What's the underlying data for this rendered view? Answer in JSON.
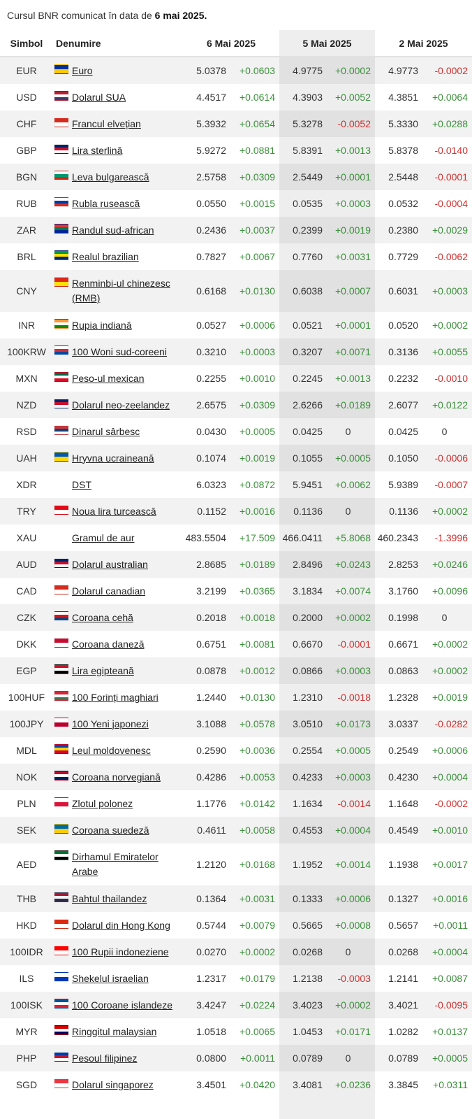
{
  "caption": {
    "prefix": "Cursul BNR comunicat în data de",
    "date": "6 mai 2025."
  },
  "headers": {
    "symbol": "Simbol",
    "name": "Denumire",
    "d1": "6 Mai 2025",
    "d2": "5 Mai 2025",
    "d3": "2 Mai 2025"
  },
  "rows": [
    {
      "sym": "EUR",
      "name": "Euro",
      "flag": [
        "#003399",
        "#ffcc00"
      ],
      "v1": "5.0378",
      "c1": "+0.0603",
      "v2": "4.9775",
      "c2": "+0.0002",
      "v3": "4.9773",
      "c3": "-0.0002"
    },
    {
      "sym": "USD",
      "name": "Dolarul SUA",
      "flag": [
        "#b22234",
        "#ffffff",
        "#3c3b6e"
      ],
      "v1": "4.4517",
      "c1": "+0.0614",
      "v2": "4.3903",
      "c2": "+0.0052",
      "v3": "4.3851",
      "c3": "+0.0064"
    },
    {
      "sym": "CHF",
      "name": "Francul elvețian",
      "flag": [
        "#d52b1e",
        "#ffffff"
      ],
      "v1": "5.3932",
      "c1": "+0.0654",
      "v2": "5.3278",
      "c2": "-0.0052",
      "v3": "5.3330",
      "c3": "+0.0288"
    },
    {
      "sym": "GBP",
      "name": "Lira sterlină",
      "flag": [
        "#012169",
        "#c8102e",
        "#ffffff"
      ],
      "v1": "5.9272",
      "c1": "+0.0881",
      "v2": "5.8391",
      "c2": "+0.0013",
      "v3": "5.8378",
      "c3": "-0.0140"
    },
    {
      "sym": "BGN",
      "name": "Leva bulgarească",
      "flag": [
        "#ffffff",
        "#00966e",
        "#d62612"
      ],
      "v1": "2.5758",
      "c1": "+0.0309",
      "v2": "2.5449",
      "c2": "+0.0001",
      "v3": "2.5448",
      "c3": "-0.0001"
    },
    {
      "sym": "RUB",
      "name": "Rubla rusească",
      "flag": [
        "#ffffff",
        "#0039a6",
        "#d52b1e"
      ],
      "v1": "0.0550",
      "c1": "+0.0015",
      "v2": "0.0535",
      "c2": "+0.0003",
      "v3": "0.0532",
      "c3": "-0.0004"
    },
    {
      "sym": "ZAR",
      "name": "Randul sud-african",
      "flag": [
        "#de3831",
        "#007a4d",
        "#002395"
      ],
      "v1": "0.2436",
      "c1": "+0.0037",
      "v2": "0.2399",
      "c2": "+0.0019",
      "v3": "0.2380",
      "c3": "+0.0029"
    },
    {
      "sym": "BRL",
      "name": "Realul brazilian",
      "flag": [
        "#009c3b",
        "#ffdf00",
        "#002776"
      ],
      "v1": "0.7827",
      "c1": "+0.0067",
      "v2": "0.7760",
      "c2": "+0.0031",
      "v3": "0.7729",
      "c3": "-0.0062"
    },
    {
      "sym": "CNY",
      "name": "Renminbi-ul chinezesc (RMB)",
      "tall": true,
      "flag": [
        "#de2910",
        "#ffde00"
      ],
      "v1": "0.6168",
      "c1": "+0.0130",
      "v2": "0.6038",
      "c2": "+0.0007",
      "v3": "0.6031",
      "c3": "+0.0003"
    },
    {
      "sym": "INR",
      "name": "Rupia indiană",
      "flag": [
        "#ff9933",
        "#ffffff",
        "#138808"
      ],
      "v1": "0.0527",
      "c1": "+0.0006",
      "v2": "0.0521",
      "c2": "+0.0001",
      "v3": "0.0520",
      "c3": "+0.0002"
    },
    {
      "sym": "100KRW",
      "name": "100 Woni sud-coreeni",
      "flag": [
        "#ffffff",
        "#cd2e3a",
        "#0047a0"
      ],
      "v1": "0.3210",
      "c1": "+0.0003",
      "v2": "0.3207",
      "c2": "+0.0071",
      "v3": "0.3136",
      "c3": "+0.0055"
    },
    {
      "sym": "MXN",
      "name": "Peso-ul mexican",
      "flag": [
        "#006847",
        "#ffffff",
        "#ce1126"
      ],
      "v1": "0.2255",
      "c1": "+0.0010",
      "v2": "0.2245",
      "c2": "+0.0013",
      "v3": "0.2232",
      "c3": "-0.0010"
    },
    {
      "sym": "NZD",
      "name": "Dolarul neo-zeelandez",
      "flag": [
        "#012169",
        "#c8102e",
        "#ffffff"
      ],
      "v1": "2.6575",
      "c1": "+0.0309",
      "v2": "2.6266",
      "c2": "+0.0189",
      "v3": "2.6077",
      "c3": "+0.0122"
    },
    {
      "sym": "RSD",
      "name": "Dinarul sârbesc",
      "flag": [
        "#c6363c",
        "#0c4076",
        "#ffffff"
      ],
      "v1": "0.0430",
      "c1": "+0.0005",
      "v2": "0.0425",
      "c2": "0",
      "v3": "0.0425",
      "c3": "0"
    },
    {
      "sym": "UAH",
      "name": "Hryvna ucraineană",
      "flag": [
        "#0057b7",
        "#ffd700"
      ],
      "v1": "0.1074",
      "c1": "+0.0019",
      "v2": "0.1055",
      "c2": "+0.0005",
      "v3": "0.1050",
      "c3": "-0.0006"
    },
    {
      "sym": "XDR",
      "name": "DST",
      "flag": [],
      "v1": "6.0323",
      "c1": "+0.0872",
      "v2": "5.9451",
      "c2": "+0.0062",
      "v3": "5.9389",
      "c3": "-0.0007"
    },
    {
      "sym": "TRY",
      "name": "Noua lira turcească",
      "flag": [
        "#e30a17",
        "#ffffff"
      ],
      "v1": "0.1152",
      "c1": "+0.0016",
      "v2": "0.1136",
      "c2": "0",
      "v3": "0.1136",
      "c3": "+0.0002"
    },
    {
      "sym": "XAU",
      "name": "Gramul de aur",
      "flag": [],
      "v1": "483.5504",
      "c1": "+17.509",
      "v2": "466.0411",
      "c2": "+5.8068",
      "v3": "460.2343",
      "c3": "-1.3996"
    },
    {
      "sym": "AUD",
      "name": "Dolarul australian",
      "flag": [
        "#012169",
        "#c8102e",
        "#ffffff"
      ],
      "v1": "2.8685",
      "c1": "+0.0189",
      "v2": "2.8496",
      "c2": "+0.0243",
      "v3": "2.8253",
      "c3": "+0.0246"
    },
    {
      "sym": "CAD",
      "name": "Dolarul canadian",
      "flag": [
        "#d52b1e",
        "#ffffff"
      ],
      "v1": "3.2199",
      "c1": "+0.0365",
      "v2": "3.1834",
      "c2": "+0.0074",
      "v3": "3.1760",
      "c3": "+0.0096"
    },
    {
      "sym": "CZK",
      "name": "Coroana cehă",
      "flag": [
        "#ffffff",
        "#d7141a",
        "#11457e"
      ],
      "v1": "0.2018",
      "c1": "+0.0018",
      "v2": "0.2000",
      "c2": "+0.0002",
      "v3": "0.1998",
      "c3": "0"
    },
    {
      "sym": "DKK",
      "name": "Coroana daneză",
      "flag": [
        "#c60c30",
        "#ffffff"
      ],
      "v1": "0.6751",
      "c1": "+0.0081",
      "v2": "0.6670",
      "c2": "-0.0001",
      "v3": "0.6671",
      "c3": "+0.0002"
    },
    {
      "sym": "EGP",
      "name": "Lira egipteană",
      "flag": [
        "#ce1126",
        "#ffffff",
        "#000000"
      ],
      "v1": "0.0878",
      "c1": "+0.0012",
      "v2": "0.0866",
      "c2": "+0.0003",
      "v3": "0.0863",
      "c3": "+0.0002"
    },
    {
      "sym": "100HUF",
      "name": "100 Forinți maghiari",
      "flag": [
        "#ce2939",
        "#ffffff",
        "#477050"
      ],
      "v1": "1.2440",
      "c1": "+0.0130",
      "v2": "1.2310",
      "c2": "-0.0018",
      "v3": "1.2328",
      "c3": "+0.0019"
    },
    {
      "sym": "100JPY",
      "name": "100 Yeni japonezi",
      "flag": [
        "#ffffff",
        "#bc002d"
      ],
      "v1": "3.1088",
      "c1": "+0.0578",
      "v2": "3.0510",
      "c2": "+0.0173",
      "v3": "3.0337",
      "c3": "-0.0282"
    },
    {
      "sym": "MDL",
      "name": "Leul moldovenesc",
      "flag": [
        "#0046ae",
        "#ffd200",
        "#cc092f"
      ],
      "v1": "0.2590",
      "c1": "+0.0036",
      "v2": "0.2554",
      "c2": "+0.0005",
      "v3": "0.2549",
      "c3": "+0.0006"
    },
    {
      "sym": "NOK",
      "name": "Coroana norvegiană",
      "flag": [
        "#ba0c2f",
        "#ffffff",
        "#00205b"
      ],
      "v1": "0.4286",
      "c1": "+0.0053",
      "v2": "0.4233",
      "c2": "+0.0003",
      "v3": "0.4230",
      "c3": "+0.0004"
    },
    {
      "sym": "PLN",
      "name": "Zlotul polonez",
      "flag": [
        "#ffffff",
        "#dc143c"
      ],
      "v1": "1.1776",
      "c1": "+0.0142",
      "v2": "1.1634",
      "c2": "-0.0014",
      "v3": "1.1648",
      "c3": "-0.0002"
    },
    {
      "sym": "SEK",
      "name": "Coroana suedeză",
      "flag": [
        "#006aa7",
        "#fecc00"
      ],
      "v1": "0.4611",
      "c1": "+0.0058",
      "v2": "0.4553",
      "c2": "+0.0004",
      "v3": "0.4549",
      "c3": "+0.0010"
    },
    {
      "sym": "AED",
      "name": "Dirhamul Emiratelor Arabe",
      "tall": true,
      "flag": [
        "#00732f",
        "#ffffff",
        "#000000",
        "#ff0000"
      ],
      "v1": "1.2120",
      "c1": "+0.0168",
      "v2": "1.1952",
      "c2": "+0.0014",
      "v3": "1.1938",
      "c3": "+0.0017"
    },
    {
      "sym": "THB",
      "name": "Bahtul thailandez",
      "flag": [
        "#a51931",
        "#f4f5f8",
        "#2d2a4a"
      ],
      "v1": "0.1364",
      "c1": "+0.0031",
      "v2": "0.1333",
      "c2": "+0.0006",
      "v3": "0.1327",
      "c3": "+0.0016"
    },
    {
      "sym": "HKD",
      "name": "Dolarul din Hong Kong",
      "flag": [
        "#de2910",
        "#ffffff"
      ],
      "v1": "0.5744",
      "c1": "+0.0079",
      "v2": "0.5665",
      "c2": "+0.0008",
      "v3": "0.5657",
      "c3": "+0.0011"
    },
    {
      "sym": "100IDR",
      "name": "100 Rupii indoneziene",
      "flag": [
        "#ff0000",
        "#ffffff"
      ],
      "v1": "0.0270",
      "c1": "+0.0002",
      "v2": "0.0268",
      "c2": "0",
      "v3": "0.0268",
      "c3": "+0.0004"
    },
    {
      "sym": "ILS",
      "name": "Shekelul israelian",
      "flag": [
        "#ffffff",
        "#0038b8"
      ],
      "v1": "1.2317",
      "c1": "+0.0179",
      "v2": "1.2138",
      "c2": "-0.0003",
      "v3": "1.2141",
      "c3": "+0.0087"
    },
    {
      "sym": "100ISK",
      "name": "100 Coroane islandeze",
      "flag": [
        "#02529c",
        "#ffffff",
        "#dc1e35"
      ],
      "v1": "3.4247",
      "c1": "+0.0224",
      "v2": "3.4023",
      "c2": "+0.0002",
      "v3": "3.4021",
      "c3": "-0.0095"
    },
    {
      "sym": "MYR",
      "name": "Ringgitul malaysian",
      "flag": [
        "#cc0001",
        "#ffffff",
        "#010066",
        "#ffcc00"
      ],
      "v1": "1.0518",
      "c1": "+0.0065",
      "v2": "1.0453",
      "c2": "+0.0171",
      "v3": "1.0282",
      "c3": "+0.0137"
    },
    {
      "sym": "PHP",
      "name": "Pesoul filipinez",
      "flag": [
        "#0038a8",
        "#ce1126",
        "#ffffff"
      ],
      "v1": "0.0800",
      "c1": "+0.0011",
      "v2": "0.0789",
      "c2": "0",
      "v3": "0.0789",
      "c3": "+0.0005"
    },
    {
      "sym": "SGD",
      "name": "Dolarul singaporez",
      "flag": [
        "#ef3340",
        "#ffffff"
      ],
      "v1": "3.4501",
      "c1": "+0.0420",
      "v2": "3.4081",
      "c2": "+0.0236",
      "v3": "3.3845",
      "c3": "+0.0311"
    }
  ]
}
